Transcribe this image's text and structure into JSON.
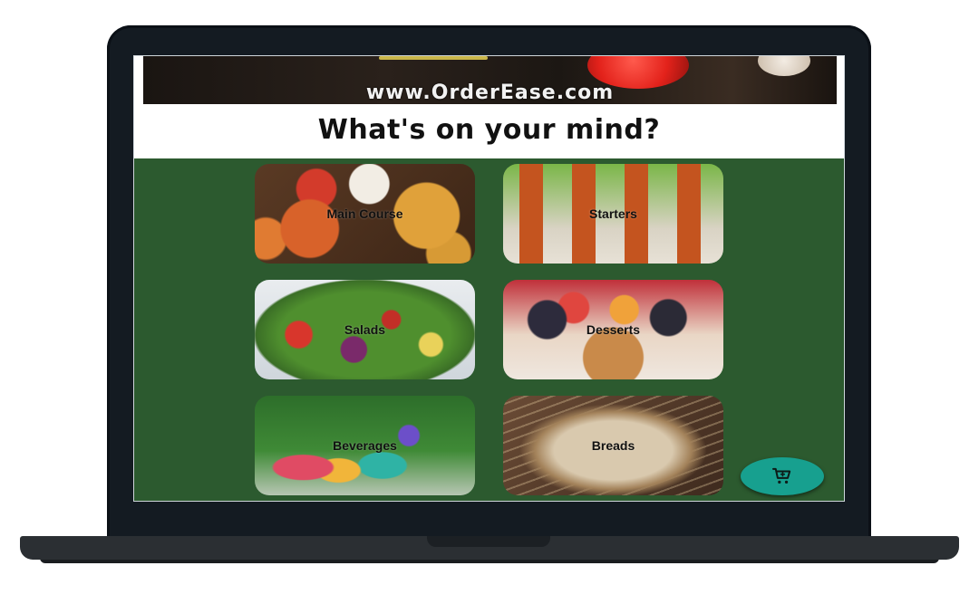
{
  "header": {
    "site_url": "www.OrderEase.com",
    "question": "What's on your mind?"
  },
  "categories": [
    {
      "label": "Main Course"
    },
    {
      "label": "Starters"
    },
    {
      "label": "Salads"
    },
    {
      "label": "Desserts"
    },
    {
      "label": "Beverages"
    },
    {
      "label": "Breads"
    }
  ],
  "cart_button": {
    "icon": "cart-icon"
  },
  "colors": {
    "screen_background": "#2c5a2f",
    "fab": "#17a08f",
    "laptop_frame": "#141b22"
  }
}
